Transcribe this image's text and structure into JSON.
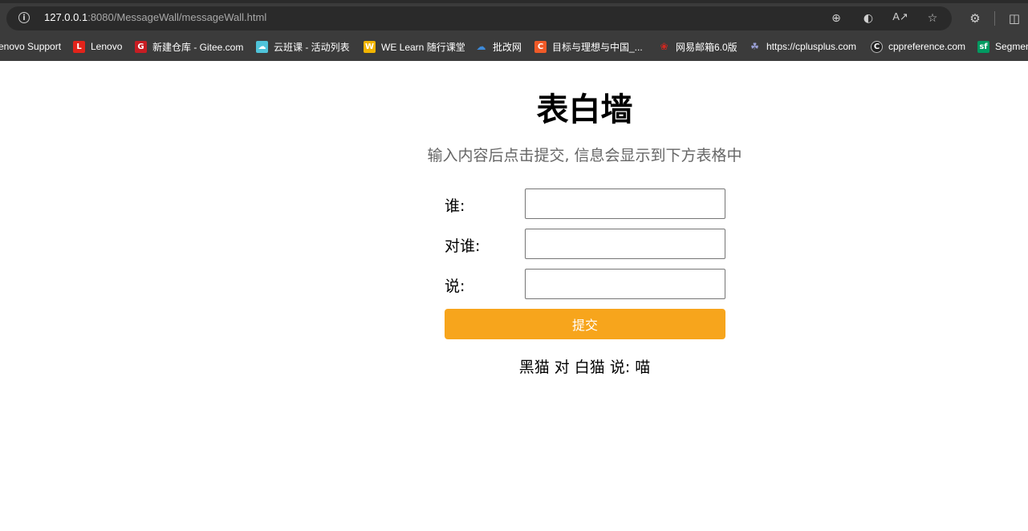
{
  "browser": {
    "url_host": "127.0.0.1",
    "url_rest": ":8080/MessageWall/messageWall.html",
    "bookmarks": [
      {
        "label": "enovo Support",
        "icon": "lenovo-support-icon",
        "color": ""
      },
      {
        "label": "Lenovo",
        "icon": "lenovo-icon",
        "color": "#e2231a"
      },
      {
        "label": "新建仓库 - Gitee.com",
        "icon": "gitee-icon",
        "color": "#c71d23"
      },
      {
        "label": "云班课 - 活动列表",
        "icon": "cloud-class-icon",
        "color": "#4fc3d9"
      },
      {
        "label": "WE Learn 随行课堂",
        "icon": "welearn-icon",
        "color": "#f2b400"
      },
      {
        "label": "批改网",
        "icon": "pigai-icon",
        "color": "#3d8ad9"
      },
      {
        "label": "目标与理想与中国_...",
        "icon": "c-brand-icon",
        "color": "#f05a28"
      },
      {
        "label": "网易邮箱6.0版",
        "icon": "netease-mail-icon",
        "color": "#d7261e"
      },
      {
        "label": "https://cplusplus.com",
        "icon": "cplusplus-icon",
        "color": "#9aa0d6"
      },
      {
        "label": "cppreference.com",
        "icon": "cppreference-icon",
        "color": "#222222"
      },
      {
        "label": "Segmen",
        "icon": "segmentfault-icon",
        "color": "#009a61"
      }
    ]
  },
  "page": {
    "title": "表白墙",
    "subtitle": "输入内容后点击提交, 信息会显示到下方表格中",
    "fields": [
      {
        "label": "谁:",
        "value": ""
      },
      {
        "label": "对谁:",
        "value": ""
      },
      {
        "label": "说:",
        "value": ""
      }
    ],
    "submit_label": "提交",
    "messages": [
      {
        "text": "黑猫 对 白猫 说: 喵"
      }
    ]
  },
  "colors": {
    "accent": "#f7a51c",
    "subtitle": "#666666",
    "chrome": "#3b3b3b"
  }
}
